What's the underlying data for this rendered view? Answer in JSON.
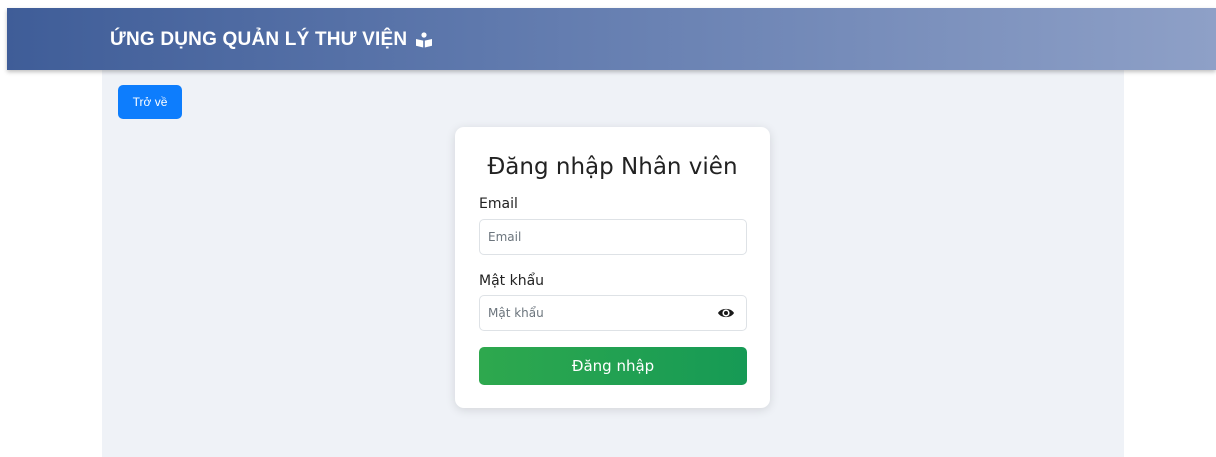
{
  "header": {
    "app_title": "ỨNG DỤNG QUẢN LÝ THƯ VIỆN",
    "icon": "book-reader-icon",
    "gradient": [
      "#3f5d98",
      "#8ea0c7"
    ]
  },
  "toolbar": {
    "back_label": "Trở về",
    "back_color": "#0d7dfd"
  },
  "login_form": {
    "title": "Đăng nhập Nhân viên",
    "email": {
      "label": "Email",
      "placeholder": "Email",
      "value": ""
    },
    "password": {
      "label": "Mật khẩu",
      "placeholder": "Mật khẩu",
      "value": "",
      "toggle_icon": "eye-icon"
    },
    "submit_label": "Đăng nhập",
    "submit_color": "#28a745"
  }
}
